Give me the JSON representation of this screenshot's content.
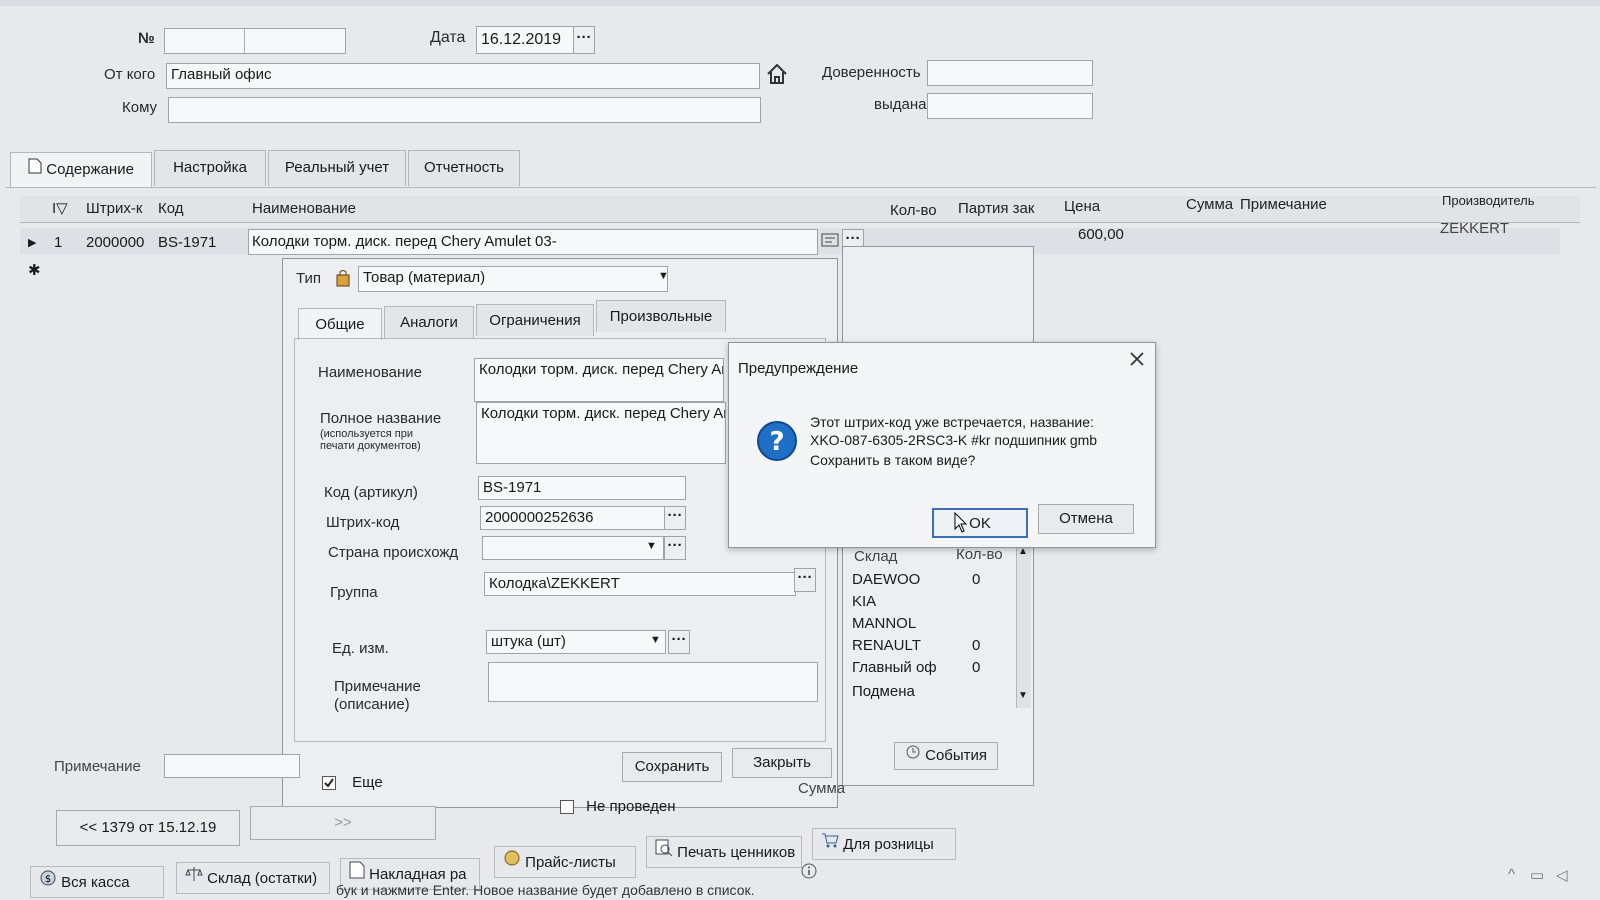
{
  "header": {
    "number_label": "№",
    "date_label": "Дата",
    "date_value": "16.12.2019",
    "from_label": "От кого",
    "from_value": "Главный офис",
    "to_label": "Кому",
    "proxy_label": "Доверенность",
    "issued_label": "выдана"
  },
  "tabs": [
    "Содержание",
    "Настройка",
    "Реальный учет",
    "Отчетность"
  ],
  "grid": {
    "columns": {
      "barcode": "Штрих-к",
      "code": "Код",
      "name": "Наименование",
      "qty": "Кол-во",
      "batch": "Партия зак",
      "price": "Цена",
      "sum": "Сумма",
      "note": "Примечание",
      "maker": "Производитель"
    },
    "row": {
      "num": "1",
      "barcode": "2000000",
      "code": "BS-1971",
      "name": "Колодки торм. диск. перед Chery Amulet 03-",
      "price": "600,00",
      "maker": "ZEKKERT"
    },
    "new_row_marker": "✱"
  },
  "item_window": {
    "type_label": "Тип",
    "type_value": "Товар (материал)",
    "tabs": [
      "Общие",
      "Аналоги",
      "Ограничения",
      "Произвольные"
    ],
    "name_label": "Наименование",
    "name_value": "Колодки торм. диск. перед Chery Am",
    "fullname_label": "Полное название",
    "fullname_hint": "(используется при печати документов)",
    "fullname_value": "Колодки торм. диск. перед Chery Am",
    "code_label": "Код (артикул)",
    "code_value": "BS-1971",
    "barcode_label": "Штрих-код",
    "barcode_value": "2000000252636",
    "country_label": "Страна происхожд",
    "group_label": "Группа",
    "group_value": "Колодка\\ZEKKERT",
    "unit_label": "Ед. изм.",
    "unit_value": "штука (шт)",
    "note_label": "Примечание (описание)",
    "more_label": "Еще",
    "save_button": "Сохранить",
    "close_button": "Закрыть"
  },
  "stock": {
    "col_warehouse": "Склад",
    "col_qty": "Кол-во",
    "rows": [
      {
        "name": "DAEWOO",
        "qty": "0"
      },
      {
        "name": "KIA",
        "qty": ""
      },
      {
        "name": "MANNOL",
        "qty": ""
      },
      {
        "name": "RENAULT",
        "qty": "0"
      },
      {
        "name": "Главный оф",
        "qty": "0"
      },
      {
        "name": "Подмена",
        "qty": ""
      }
    ],
    "events_button": "События"
  },
  "warning": {
    "title": "Предупреждение",
    "line1": "Этот штрих-код уже встречается, название:",
    "line2": "XKO-087-6305-2RSC3-K #kr подшипник gmb",
    "line3": "Сохранить в таком виде?",
    "ok": "OK",
    "cancel": "Отмена"
  },
  "footer": {
    "note_label": "Примечание",
    "prev_doc": "<< 1379 от 15.12.19",
    "next_doc": ">>",
    "sum_label": "Сумма",
    "not_posted": "Не проведен",
    "toolbar": [
      "Вся касса",
      "Склад (остатки)",
      "Накладная ра",
      "Прайс-листы",
      "Печать ценников",
      "Для розницы"
    ],
    "status_text": "бук и нажмите Enter. Новое название будет добавлено в список."
  },
  "colors": {
    "grid_row": "#dde0e4",
    "window_bg": "#eceef1",
    "help_icon": "#1f6fc6"
  }
}
